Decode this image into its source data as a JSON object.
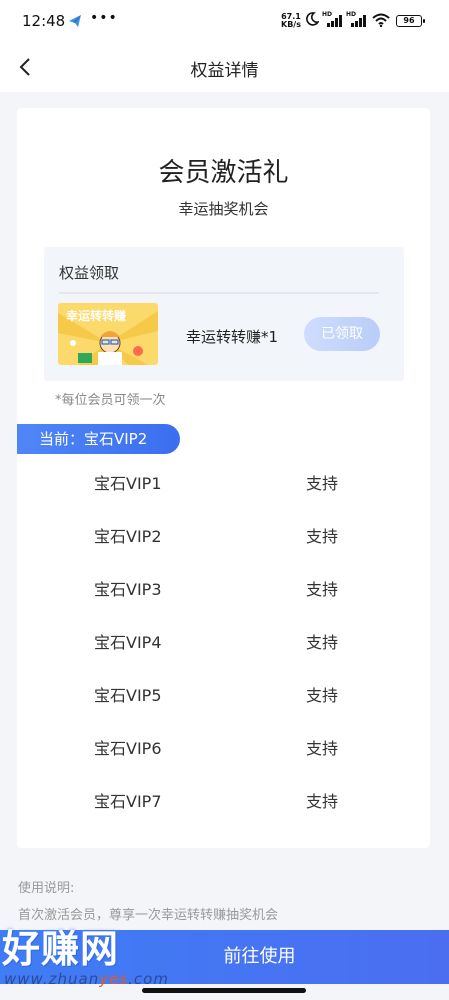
{
  "status_bar": {
    "time": "12:48",
    "more": "•••",
    "speed_value": "67.1",
    "speed_unit": "KB/s",
    "signal_label": "HD",
    "battery": "96"
  },
  "nav": {
    "title": "权益详情"
  },
  "card": {
    "title": "会员激活礼",
    "subtitle": "幸运抽奖机会"
  },
  "benefit": {
    "section_title": "权益领取",
    "item_label": "幸运转转赚*1",
    "thumb_text": "幸运转转赚",
    "button_label": "已领取",
    "note": "*每位会员可领一次"
  },
  "current": {
    "label": "当前：宝石VIP2"
  },
  "levels": [
    {
      "name": "宝石VIP1",
      "support": "支持"
    },
    {
      "name": "宝石VIP2",
      "support": "支持"
    },
    {
      "name": "宝石VIP3",
      "support": "支持"
    },
    {
      "name": "宝石VIP4",
      "support": "支持"
    },
    {
      "name": "宝石VIP5",
      "support": "支持"
    },
    {
      "name": "宝石VIP6",
      "support": "支持"
    },
    {
      "name": "宝石VIP7",
      "support": "支持"
    }
  ],
  "usage": {
    "title": "使用说明:",
    "text": "首次激活会员，尊享一次幸运转转赚抽奖机会"
  },
  "action": {
    "label": "前往使用"
  },
  "watermark": {
    "logo": "好赚网",
    "url_prefix": "www.zhuan",
    "url_highlight": "yes",
    "url_suffix": ".com"
  },
  "colors": {
    "accent": "#3f7df5",
    "claimed_button": "#c4d5fb",
    "page_bg": "#f3f5f9"
  }
}
